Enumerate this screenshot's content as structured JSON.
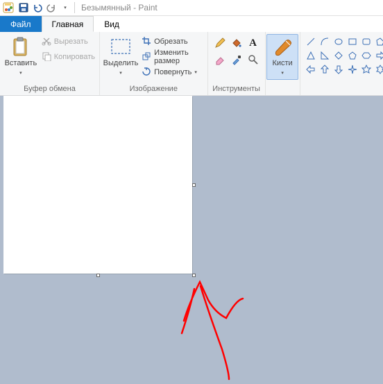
{
  "window": {
    "title": "Безымянный - Paint"
  },
  "tabs": {
    "file": "Файл",
    "home": "Главная",
    "view": "Вид"
  },
  "clipboard": {
    "group_label": "Буфер обмена",
    "paste": "Вставить",
    "cut": "Вырезать",
    "copy": "Копировать"
  },
  "image": {
    "group_label": "Изображение",
    "select": "Выделить",
    "crop": "Обрезать",
    "resize": "Изменить размер",
    "rotate": "Повернуть"
  },
  "tools": {
    "group_label": "Инструменты"
  },
  "brushes": {
    "label": "Кисти"
  },
  "colors": {
    "accent": "#1979ca",
    "brush_orange": "#e08a2c"
  },
  "icons": {
    "save": "save",
    "undo": "undo",
    "redo": "redo",
    "scissors": "scissors",
    "copy": "copy",
    "clipboard": "clipboard",
    "select": "select-rect",
    "crop": "crop",
    "resize": "resize",
    "rotate": "rotate",
    "pencil": "pencil",
    "bucket": "bucket",
    "text": "text",
    "eraser": "eraser",
    "picker": "picker",
    "zoom": "zoom",
    "brush": "brush"
  }
}
